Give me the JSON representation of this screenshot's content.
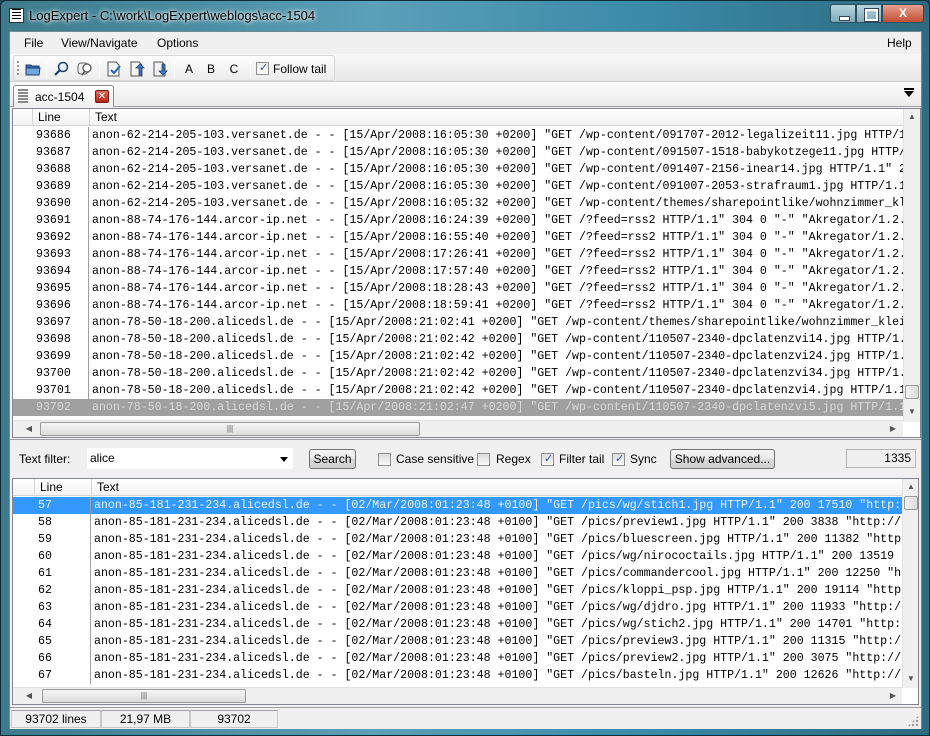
{
  "window": {
    "title": "LogExpert - C:\\work\\LogExpert\\weblogs\\acc-1504",
    "close_glyph": "X"
  },
  "menu": {
    "items": [
      "File",
      "View/Navigate",
      "Options"
    ],
    "help": "Help"
  },
  "toolbar": {
    "buttons": [
      "open-file",
      "search",
      "filter-search",
      "bookmark-toggle",
      "bookmark-previous",
      "bookmark-next"
    ],
    "letters": [
      "A",
      "B",
      "C"
    ],
    "follow_tail_label": "Follow tail",
    "follow_tail_checked": true
  },
  "tabs": [
    {
      "label": "acc-1504",
      "close_glyph": "✕"
    }
  ],
  "log_view": {
    "columns": [
      "Line",
      "Text"
    ],
    "selected_line": "93702",
    "rows": [
      {
        "line": "93686",
        "text": "anon-62-214-205-103.versanet.de - - [15/Apr/2008:16:05:30 +0200] \"GET /wp-content/091707-2012-legalizeit11.jpg HTTP/1"
      },
      {
        "line": "93687",
        "text": "anon-62-214-205-103.versanet.de - - [15/Apr/2008:16:05:30 +0200] \"GET /wp-content/091507-1518-babykotzege11.jpg HTTP/"
      },
      {
        "line": "93688",
        "text": "anon-62-214-205-103.versanet.de - - [15/Apr/2008:16:05:30 +0200] \"GET /wp-content/091407-2156-inear14.jpg HTTP/1.1\" 2"
      },
      {
        "line": "93689",
        "text": "anon-62-214-205-103.versanet.de - - [15/Apr/2008:16:05:30 +0200] \"GET /wp-content/091007-2053-strafraum1.jpg HTTP/1.1"
      },
      {
        "line": "93690",
        "text": "anon-62-214-205-103.versanet.de - - [15/Apr/2008:16:05:32 +0200] \"GET /wp-content/themes/sharepointlike/wohnzimmer_kl"
      },
      {
        "line": "93691",
        "text": "anon-88-74-176-144.arcor-ip.net - - [15/Apr/2008:16:24:39 +0200] \"GET /?feed=rss2 HTTP/1.1\" 304 0 \"-\" \"Akregator/1.2."
      },
      {
        "line": "93692",
        "text": "anon-88-74-176-144.arcor-ip.net - - [15/Apr/2008:16:55:40 +0200] \"GET /?feed=rss2 HTTP/1.1\" 304 0 \"-\" \"Akregator/1.2."
      },
      {
        "line": "93693",
        "text": "anon-88-74-176-144.arcor-ip.net - - [15/Apr/2008:17:26:41 +0200] \"GET /?feed=rss2 HTTP/1.1\" 304 0 \"-\" \"Akregator/1.2."
      },
      {
        "line": "93694",
        "text": "anon-88-74-176-144.arcor-ip.net - - [15/Apr/2008:17:57:40 +0200] \"GET /?feed=rss2 HTTP/1.1\" 304 0 \"-\" \"Akregator/1.2."
      },
      {
        "line": "93695",
        "text": "anon-88-74-176-144.arcor-ip.net - - [15/Apr/2008:18:28:43 +0200] \"GET /?feed=rss2 HTTP/1.1\" 304 0 \"-\" \"Akregator/1.2."
      },
      {
        "line": "93696",
        "text": "anon-88-74-176-144.arcor-ip.net - - [15/Apr/2008:18:59:41 +0200] \"GET /?feed=rss2 HTTP/1.1\" 304 0 \"-\" \"Akregator/1.2."
      },
      {
        "line": "93697",
        "text": "anon-78-50-18-200.alicedsl.de - - [15/Apr/2008:21:02:41 +0200] \"GET /wp-content/themes/sharepointlike/wohnzimmer_klei"
      },
      {
        "line": "93698",
        "text": "anon-78-50-18-200.alicedsl.de - - [15/Apr/2008:21:02:42 +0200] \"GET /wp-content/110507-2340-dpclatenzvi14.jpg HTTP/1."
      },
      {
        "line": "93699",
        "text": "anon-78-50-18-200.alicedsl.de - - [15/Apr/2008:21:02:42 +0200] \"GET /wp-content/110507-2340-dpclatenzvi24.jpg HTTP/1."
      },
      {
        "line": "93700",
        "text": "anon-78-50-18-200.alicedsl.de - - [15/Apr/2008:21:02:42 +0200] \"GET /wp-content/110507-2340-dpclatenzvi34.jpg HTTP/1."
      },
      {
        "line": "93701",
        "text": "anon-78-50-18-200.alicedsl.de - - [15/Apr/2008:21:02:42 +0200] \"GET /wp-content/110507-2340-dpclatenzvi4.jpg HTTP/1.1"
      },
      {
        "line": "93702",
        "text": "anon-78-50-18-200.alicedsl.de - - [15/Apr/2008:21:02:47 +0200] \"GET /wp-content/110507-2340-dpclatenzvi5.jpg HTTP/1.1"
      }
    ]
  },
  "filter": {
    "label": "Text filter:",
    "value": "alice",
    "search_label": "Search",
    "case_sensitive_label": "Case sensitive",
    "case_sensitive_checked": false,
    "regex_label": "Regex",
    "regex_checked": false,
    "filter_tail_label": "Filter tail",
    "filter_tail_checked": true,
    "sync_label": "Sync",
    "sync_checked": true,
    "advanced_label": "Show advanced...",
    "result_count": "1335"
  },
  "filter_view": {
    "columns": [
      "Line",
      "Text"
    ],
    "selected_line": "57",
    "rows": [
      {
        "line": "57",
        "text": "anon-85-181-231-234.alicedsl.de - - [02/Mar/2008:01:23:48 +0100] \"GET /pics/wg/stich1.jpg HTTP/1.1\" 200 17510 \"http:"
      },
      {
        "line": "58",
        "text": "anon-85-181-231-234.alicedsl.de - - [02/Mar/2008:01:23:48 +0100] \"GET /pics/preview1.jpg HTTP/1.1\" 200 3838 \"http://"
      },
      {
        "line": "59",
        "text": "anon-85-181-231-234.alicedsl.de - - [02/Mar/2008:01:23:48 +0100] \"GET /pics/bluescreen.jpg HTTP/1.1\" 200 11382 \"http"
      },
      {
        "line": "60",
        "text": "anon-85-181-231-234.alicedsl.de - - [02/Mar/2008:01:23:48 +0100] \"GET /pics/wg/nirococtails.jpg HTTP/1.1\" 200 13519 "
      },
      {
        "line": "61",
        "text": "anon-85-181-231-234.alicedsl.de - - [02/Mar/2008:01:23:48 +0100] \"GET /pics/commandercool.jpg HTTP/1.1\" 200 12250 \"h"
      },
      {
        "line": "62",
        "text": "anon-85-181-231-234.alicedsl.de - - [02/Mar/2008:01:23:48 +0100] \"GET /pics/kloppi_psp.jpg HTTP/1.1\" 200 19114 \"http"
      },
      {
        "line": "63",
        "text": "anon-85-181-231-234.alicedsl.de - - [02/Mar/2008:01:23:48 +0100] \"GET /pics/wg/djdro.jpg HTTP/1.1\" 200 11933 \"http:/"
      },
      {
        "line": "64",
        "text": "anon-85-181-231-234.alicedsl.de - - [02/Mar/2008:01:23:48 +0100] \"GET /pics/wg/stich2.jpg HTTP/1.1\" 200 14701 \"http:"
      },
      {
        "line": "65",
        "text": "anon-85-181-231-234.alicedsl.de - - [02/Mar/2008:01:23:48 +0100] \"GET /pics/preview3.jpg HTTP/1.1\" 200 11315 \"http:/"
      },
      {
        "line": "66",
        "text": "anon-85-181-231-234.alicedsl.de - - [02/Mar/2008:01:23:48 +0100] \"GET /pics/preview2.jpg HTTP/1.1\" 200 3075 \"http://"
      },
      {
        "line": "67",
        "text": "anon-85-181-231-234.alicedsl.de - - [02/Mar/2008:01:23:48 +0100] \"GET /pics/basteln.jpg HTTP/1.1\" 200 12626 \"http://"
      }
    ]
  },
  "statusbar": {
    "lines": "93702 lines",
    "size": "21,97 MB",
    "current_line": "93702"
  },
  "colors": {
    "selection_blue": "#3399ff",
    "selection_gray": "#a0a0a0"
  }
}
